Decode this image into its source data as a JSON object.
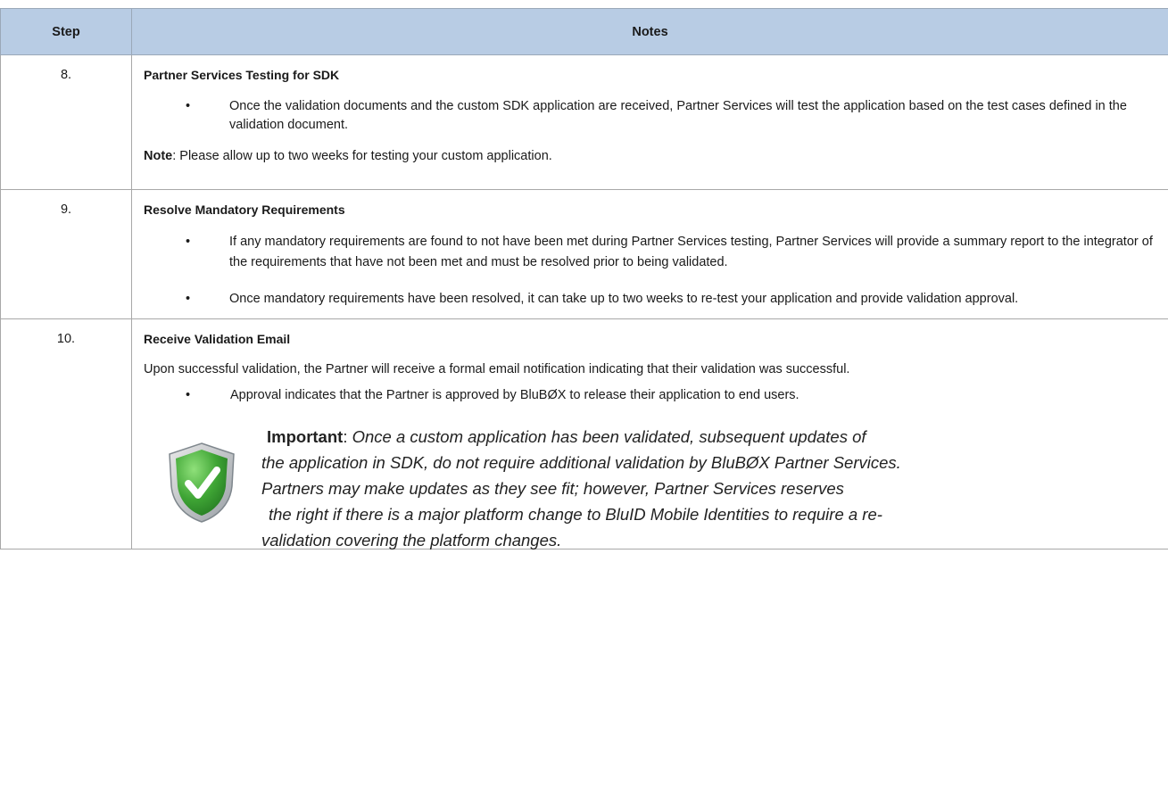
{
  "table": {
    "header": {
      "step": "Step",
      "notes": "Notes"
    },
    "rows": [
      {
        "step": "8.",
        "title": "Partner Services Testing for SDK",
        "bullets": [
          "Once the validation documents and the custom SDK application are received, Partner Services will test the application based on the test cases defined in the validation document."
        ],
        "note_label": "Note",
        "note_text": ": Please allow up to two weeks for testing your custom application."
      },
      {
        "step": "9.",
        "title": "Resolve Mandatory Requirements",
        "bullets": [
          "If any mandatory requirements are found to not have been met during Partner Services testing, Partner Services will provide a summary report to the integrator of the requirements that have not been met and must be resolved prior to being validated.",
          "Once mandatory requirements have been resolved, it can take up to two weeks to re-test your application and provide validation approval."
        ]
      },
      {
        "step": "10.",
        "title": "Receive Validation Email",
        "paragraph": "Upon successful validation, the Partner will receive a formal email notification indicating that their validation was successful.",
        "bullets": [
          "Approval indicates that the Partner is approved by BluBØX to release their application to end users."
        ],
        "important": {
          "label": "Important",
          "colon": ":",
          "line1": " Once a custom application has been validated, subsequent updates of",
          "line2": "the application in SDK, do not require additional validation by BluBØX Partner Services.",
          "line3": "Partners may make updates as they see fit; however, Partner Services reserves",
          "line4": "the right if there is a major platform change to BluID Mobile Identities to require a re-",
          "line5": "validation covering the platform changes.",
          "icon": "shield-check-icon"
        }
      }
    ]
  },
  "colors": {
    "header_bg": "#b8cce4",
    "shield_green": "#3fa535"
  }
}
